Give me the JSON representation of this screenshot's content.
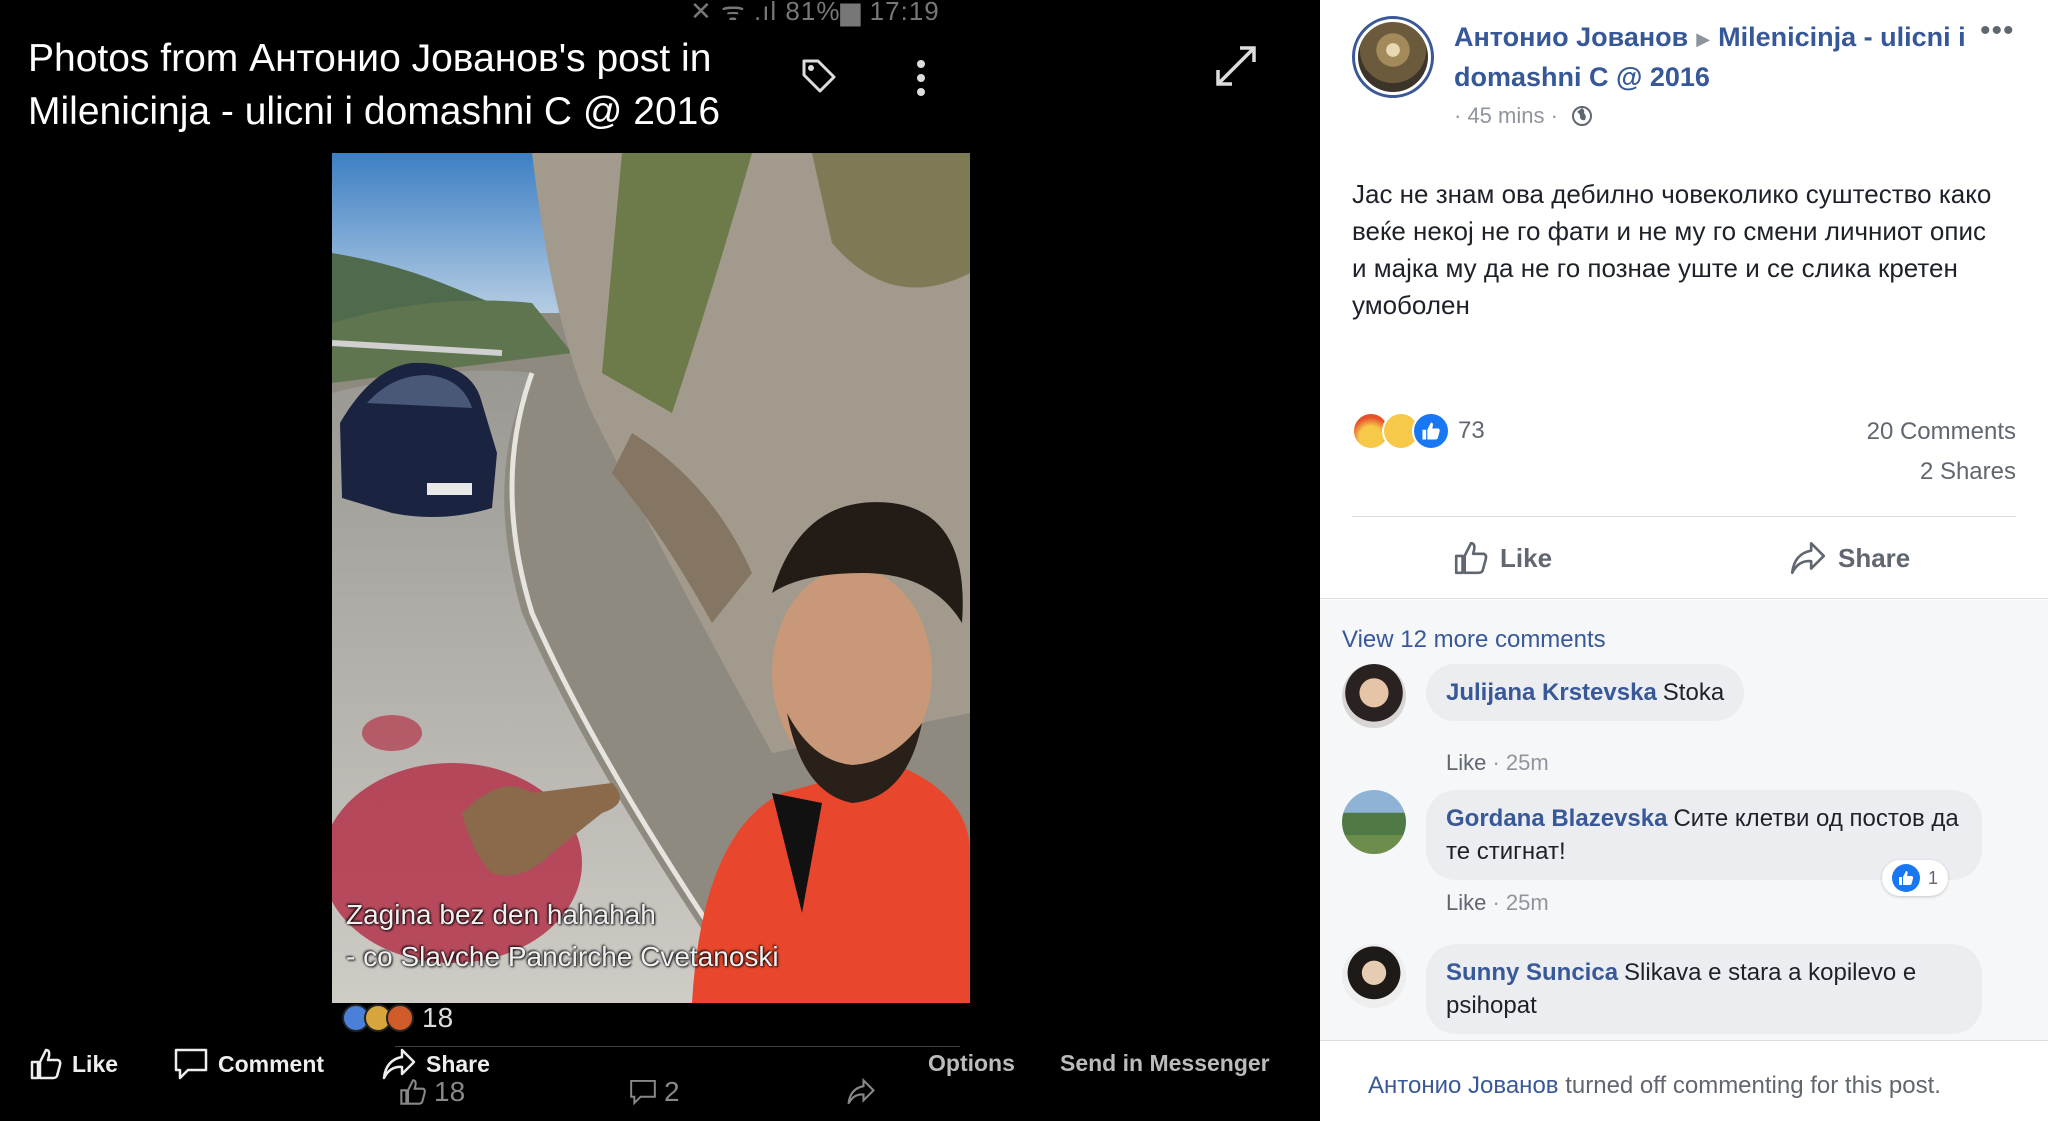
{
  "status_bar": "✕ ᯤ .ıl 81%▆ 17:19",
  "viewer": {
    "title": "Photos from Антонио Јованов's post in Milenicinja - ulicni i domashni C @ 2016",
    "caption_line1": "Zagina bez den hahahah",
    "caption_line2": "- co Slavche Pancirche Cvetanoski",
    "inner_reaction_count": "18",
    "actions": {
      "like": "Like",
      "comment": "Comment",
      "share": "Share",
      "options": "Options",
      "send": "Send in Messenger"
    },
    "counts": {
      "likes": "18",
      "comments": "2"
    }
  },
  "post": {
    "author": "Антонио Јованов",
    "group": "Milenicinja - ulicni i domashni C @ 2016",
    "more": "•••",
    "time": "· 45 mins ·",
    "body": "Јас не знам ова дебилно човеколико суштество како веќе некој не го фати и не му го смени личниот опис и мајка му да не го познае уште и се слика кретен умоболен",
    "reaction_count": "73",
    "comments_count": "20 Comments",
    "shares_count": "2 Shares",
    "like_label": "Like",
    "share_label": "Share"
  },
  "comments": {
    "view_more": "View 12 more comments",
    "items": [
      {
        "name": "Julijana Krstevska",
        "text": "Stoka",
        "like": "Like",
        "time": "· 25m"
      },
      {
        "name": "Gordana Blazevska",
        "text": "Сите клетви од постов да те стигнат!",
        "like": "Like",
        "time": "· 25m",
        "reactions": "1"
      },
      {
        "name": "Sunny Suncica",
        "text": "Slikava e stara a kopilevo e psihopat"
      }
    ]
  },
  "footer": {
    "name": "Антонио Јованов",
    "text": " turned off commenting for this post."
  },
  "colors": {
    "link": "#385898",
    "author": "#365899",
    "like_blue": "#1877f2",
    "angry": "#f0642c",
    "sad": "#f7c948"
  }
}
